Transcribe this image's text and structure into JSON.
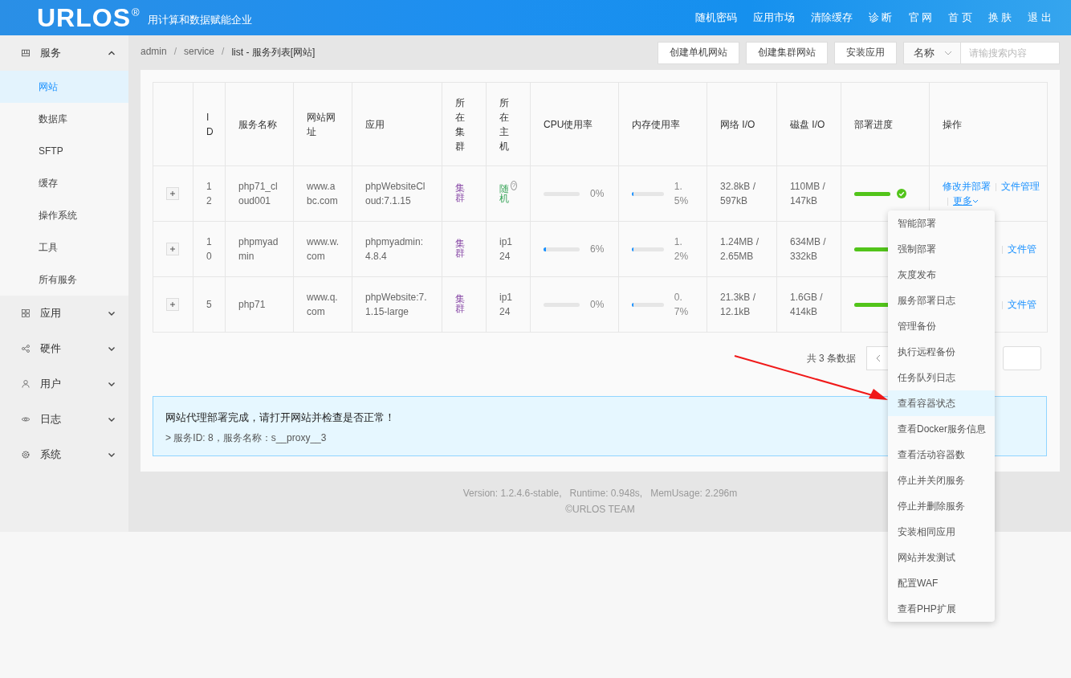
{
  "header": {
    "logo": "URLOS",
    "logo_mark": "®",
    "tagline": "用计算和数据赋能企业",
    "nav": [
      "随机密码",
      "应用市场",
      "清除缓存",
      "诊 断",
      "官 网",
      "首 页",
      "换 肤",
      "退 出"
    ]
  },
  "sidebar": {
    "items": [
      {
        "label": "服务",
        "expanded": true,
        "children": [
          {
            "label": "网站",
            "selected": true
          },
          {
            "label": "数据库",
            "selected": false
          },
          {
            "label": "SFTP",
            "selected": false
          },
          {
            "label": "缓存",
            "selected": false
          },
          {
            "label": "操作系统",
            "selected": false
          },
          {
            "label": "工具",
            "selected": false
          },
          {
            "label": "所有服务",
            "selected": false
          }
        ]
      },
      {
        "label": "应用",
        "expanded": false
      },
      {
        "label": "硬件",
        "expanded": false
      },
      {
        "label": "用户",
        "expanded": false
      },
      {
        "label": "日志",
        "expanded": false
      },
      {
        "label": "系统",
        "expanded": false
      }
    ]
  },
  "breadcrumb": [
    {
      "kind": "link",
      "text": "admin"
    },
    {
      "kind": "separator",
      "text": "/"
    },
    {
      "kind": "link",
      "text": "service"
    },
    {
      "kind": "separator",
      "text": "/"
    },
    {
      "kind": "current",
      "text": "list - 服务列表[网站]"
    }
  ],
  "toolbar": {
    "buttons": [
      "创建单机网站",
      "创建集群网站",
      "安装应用"
    ],
    "filter": "名称",
    "search": {
      "placeholder": "请输搜索内容"
    }
  },
  "table": {
    "columns": [
      "ID",
      "服务名称",
      "网站网址",
      "应用",
      "所在集群",
      "所在主机",
      "CPU使用率",
      "内存使用率",
      "网络 I/O",
      "磁盘 I/O",
      "部署进度",
      "操作"
    ],
    "rows": [
      {
        "id": "12",
        "name": "php71_cloud001",
        "url": "www.abc.com",
        "app": "phpWebsiteCloud:7.1.15",
        "cluster": "集群",
        "host": {
          "kind": "random",
          "text": "随机",
          "hint": "?"
        },
        "cpu": {
          "level": 0,
          "reading": "0%"
        },
        "mem": {
          "level": 0.015,
          "reading": "1.5%"
        },
        "net": "32.8kB / 597kB",
        "disk": "110MB / 147kB",
        "deploy": {
          "level": 1,
          "done": true
        },
        "actions": [
          "修改并部署",
          "文件管理",
          "更多"
        ]
      },
      {
        "id": "10",
        "name": "phpmyadmin",
        "url": "www.w.com",
        "app": "phpmyadmin:4.8.4",
        "cluster": "集群",
        "host": {
          "kind": "ip",
          "text": "ip124"
        },
        "cpu": {
          "level": 0.06,
          "reading": "6%"
        },
        "mem": {
          "level": 0.012,
          "reading": "1.2%"
        },
        "net": "1.24MB / 2.65MB",
        "disk": "634MB / 332kB",
        "deploy": {
          "level": 1
        },
        "actions": [
          "文件管"
        ]
      },
      {
        "id": "5",
        "name": "php71",
        "url": "www.q.com",
        "app": "phpWebsite:7.1.15-large",
        "cluster": "集群",
        "host": {
          "kind": "ip",
          "text": "ip124"
        },
        "cpu": {
          "level": 0,
          "reading": "0%"
        },
        "mem": {
          "level": 0.007,
          "reading": "0.7%"
        },
        "net": "21.3kB / 12.1kB",
        "disk": "1.6GB / 414kB",
        "deploy": {
          "level": 1
        },
        "actions": [
          "文件管"
        ]
      }
    ]
  },
  "pagination": {
    "total": "共 3 条数据"
  },
  "alert": {
    "title": "网站代理部署完成，请打开网站并检查是否正常！",
    "detail": "> 服务ID: 8，服务名称：s__proxy__3"
  },
  "footer": {
    "version": "Version: 1.2.4.6-stable,   Runtime: 0.948s,   MemUsage: 2.296m",
    "copyright": "©URLOS TEAM"
  },
  "menu": {
    "items": [
      {
        "label": "智能部署",
        "selected": false
      },
      {
        "label": "强制部署",
        "selected": false
      },
      {
        "label": "灰度发布",
        "selected": false
      },
      {
        "label": "服务部署日志",
        "selected": false
      },
      {
        "label": "管理备份",
        "selected": false
      },
      {
        "label": "执行远程备份",
        "selected": false
      },
      {
        "label": "任务队列日志",
        "selected": false
      },
      {
        "label": "查看容器状态",
        "selected": true
      },
      {
        "label": "查看Docker服务信息",
        "selected": false
      },
      {
        "label": "查看活动容器数",
        "selected": false
      },
      {
        "label": "停止并关闭服务",
        "selected": false
      },
      {
        "label": "停止并删除服务",
        "selected": false
      },
      {
        "label": "安装相同应用",
        "selected": false
      },
      {
        "label": "网站并发测试",
        "selected": false
      },
      {
        "label": "配置WAF",
        "selected": false
      },
      {
        "label": "查看PHP扩展",
        "selected": false
      }
    ]
  }
}
